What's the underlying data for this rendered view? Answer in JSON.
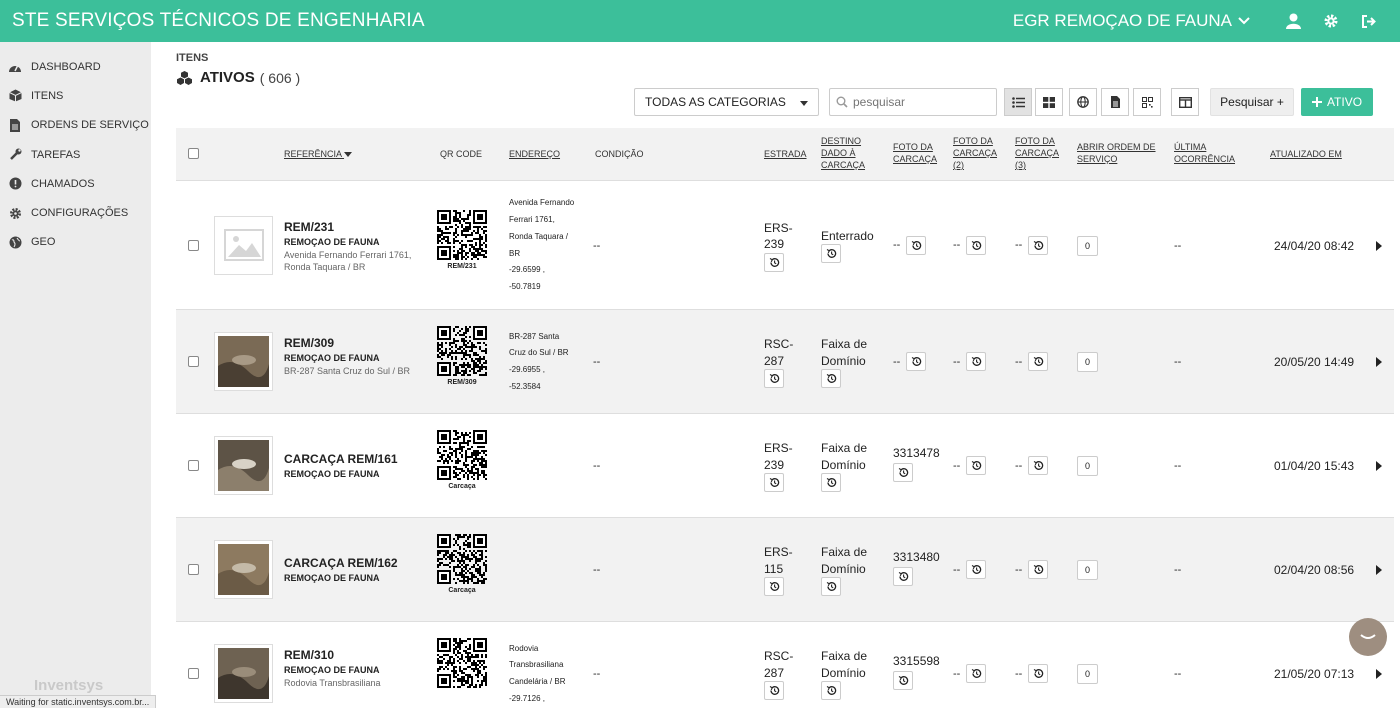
{
  "header": {
    "brand": "STE SERVIÇOS TÉCNICOS DE ENGENHARIA",
    "project": "EGR REMOÇAO DE FAUNA",
    "icons": [
      "chevron-down-icon",
      "user-icon",
      "gear-icon",
      "logout-icon"
    ]
  },
  "sidebar": {
    "items": [
      {
        "label": "DASHBOARD",
        "icon": "dashboard-icon"
      },
      {
        "label": "ITENS",
        "icon": "box-icon"
      },
      {
        "label": "ORDENS DE SERVIÇO",
        "icon": "document-icon"
      },
      {
        "label": "TAREFAS",
        "icon": "wrench-icon"
      },
      {
        "label": "CHAMADOS",
        "icon": "alert-icon"
      },
      {
        "label": "CONFIGURAÇÕES",
        "icon": "gear-icon"
      },
      {
        "label": "GEO",
        "icon": "globe-icon"
      }
    ],
    "logo": "Inventsys"
  },
  "page": {
    "breadcrumb": "ITENS",
    "title": "ATIVOS",
    "count": "( 606 )"
  },
  "toolbar": {
    "category_select": "TODAS AS CATEGORIAS",
    "search_placeholder": "pesquisar",
    "view_icons": [
      "list-view-icon",
      "grid-view-icon",
      "globe-view-icon",
      "document-view-icon",
      "qr-view-icon",
      "columns-icon"
    ],
    "search_button": "Pesquisar +",
    "add_button": "ATIVO"
  },
  "table": {
    "columns": [
      "REFERÊNCIA",
      "QR CODE",
      "ENDEREÇO",
      "CONDIÇÃO",
      "ESTRADA",
      "DESTINO DADO À CARCAÇA",
      "FOTO DA CARCAÇA",
      "FOTO DA CARCAÇA (2)",
      "FOTO DA CARCAÇA (3)",
      "ABRIR ORDEM DE SERVIÇO",
      "ÚLTIMA OCORRÊNCIA",
      "ATUALIZADO EM"
    ],
    "rows": [
      {
        "ref": "REM/231",
        "category": "REMOÇAO DE FAUNA",
        "address_short": "Avenida Fernando Ferrari 1761, Ronda Taquara / BR",
        "qr_label": "REM/231",
        "address_lines": [
          "Avenida Fernando",
          "Ferrari 1761,",
          "Ronda Taquara /",
          "BR",
          "-29.6599 ,",
          "-50.7819"
        ],
        "condition": "--",
        "road_lines": [
          "ERS-",
          "239"
        ],
        "dest_lines": [
          "Enterrado"
        ],
        "foto1": "--",
        "foto2": "--",
        "foto3": "--",
        "os_count": "0",
        "last": "--",
        "updated": "24/04/20 08:42"
      },
      {
        "ref": "REM/309",
        "category": "REMOÇAO DE FAUNA",
        "address_short": "BR-287 Santa Cruz do Sul / BR",
        "qr_label": "REM/309",
        "address_lines": [
          "BR-287 Santa",
          "Cruz do Sul / BR",
          "-29.6955 ,",
          "-52.3584"
        ],
        "condition": "--",
        "road_lines": [
          "RSC-",
          "287"
        ],
        "dest_lines": [
          "Faixa de",
          "Domínio"
        ],
        "foto1": "--",
        "foto2": "--",
        "foto3": "--",
        "os_count": "0",
        "last": "--",
        "updated": "20/05/20 14:49"
      },
      {
        "ref": "CARCAÇA REM/161",
        "category": "REMOÇAO DE FAUNA",
        "address_short": "",
        "qr_label": "Carcaça",
        "address_lines": [],
        "condition": "--",
        "road_lines": [
          "ERS-",
          "239"
        ],
        "dest_lines": [
          "Faixa de",
          "Domínio"
        ],
        "foto1": "3313478",
        "foto2": "--",
        "foto3": "--",
        "os_count": "0",
        "last": "--",
        "updated": "01/04/20 15:43"
      },
      {
        "ref": "CARCAÇA REM/162",
        "category": "REMOÇAO DE FAUNA",
        "address_short": "",
        "qr_label": "Carcaça",
        "address_lines": [],
        "condition": "--",
        "road_lines": [
          "ERS-",
          "115"
        ],
        "dest_lines": [
          "Faixa de",
          "Domínio"
        ],
        "foto1": "3313480",
        "foto2": "--",
        "foto3": "--",
        "os_count": "0",
        "last": "--",
        "updated": "02/04/20 08:56"
      },
      {
        "ref": "REM/310",
        "category": "REMOÇAO DE FAUNA",
        "address_short": "Rodovia Transbrasiliana",
        "qr_label": "",
        "address_lines": [
          "Rodovia",
          "Transbrasiliana",
          "Candelária / BR",
          "-29.7126 ,"
        ],
        "condition": "--",
        "road_lines": [
          "RSC-",
          "287"
        ],
        "dest_lines": [
          "Faixa de",
          "Domínio"
        ],
        "foto1": "3315598",
        "foto2": "--",
        "foto3": "--",
        "os_count": "0",
        "last": "--",
        "updated": "21/05/20 07:13"
      }
    ]
  },
  "status_bar": "Waiting for static.inventsys.com.br..."
}
